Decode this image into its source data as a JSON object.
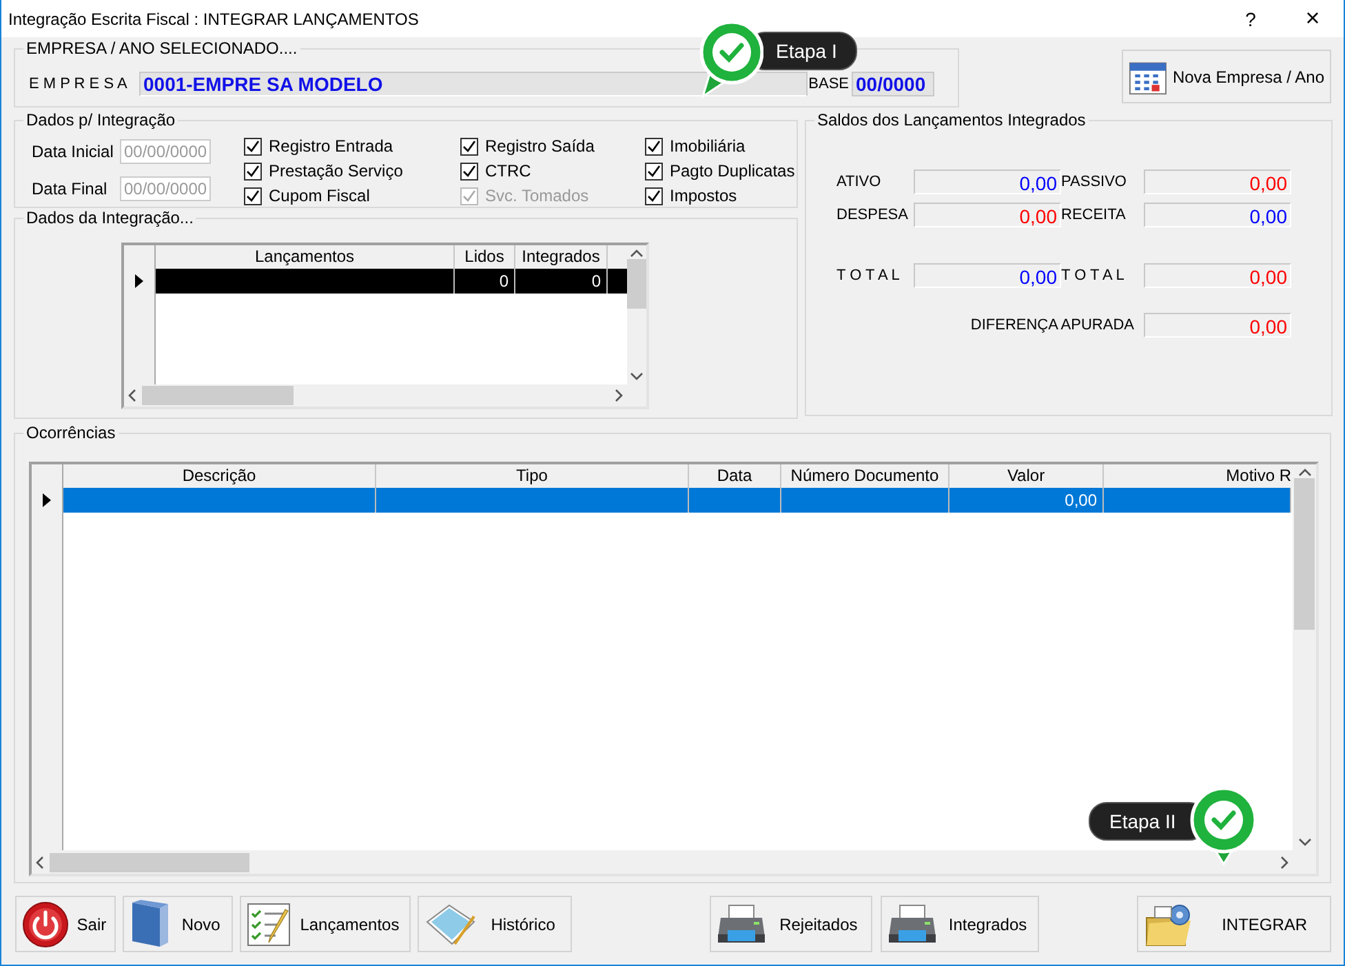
{
  "window": {
    "title": "Integração Escrita Fiscal : INTEGRAR LANÇAMENTOS",
    "help": "?",
    "close": "×"
  },
  "empresa": {
    "legend": "EMPRESA  / ANO  SELECIONADO....",
    "label": "E M P R E S A",
    "value": "0001-EMPRE SA MODELO",
    "base_label": "BASE",
    "base_value": "00/0000",
    "button": "Nova Empresa / Ano"
  },
  "dados": {
    "legend": "Dados p/ Integração",
    "dates": [
      {
        "label": "Data Inicial",
        "placeholder": "00/00/0000"
      },
      {
        "label": "Data Final",
        "placeholder": "00/00/0000"
      }
    ],
    "options": [
      {
        "label": "Registro Entrada",
        "checked": true,
        "disabled": false
      },
      {
        "label": "Prestação Serviço",
        "checked": true,
        "disabled": false
      },
      {
        "label": "Cupom Fiscal",
        "checked": true,
        "disabled": false
      },
      {
        "label": "Registro Saída",
        "checked": true,
        "disabled": false
      },
      {
        "label": "CTRC",
        "checked": true,
        "disabled": false
      },
      {
        "label": "Svc. Tomados",
        "checked": true,
        "disabled": true
      },
      {
        "label": "Imobiliária",
        "checked": true,
        "disabled": false
      },
      {
        "label": "Pagto Duplicatas",
        "checked": true,
        "disabled": false
      },
      {
        "label": "Impostos",
        "checked": true,
        "disabled": false
      }
    ]
  },
  "integracao": {
    "legend": "Dados da Integração...",
    "columns": [
      "Lançamentos",
      "Lidos",
      "Integrados"
    ],
    "rows": [
      {
        "lidos": "0",
        "integrados": "0",
        "selected": true
      }
    ]
  },
  "saldos": {
    "legend": "Saldos dos Lançamentos Integrados",
    "fields": [
      {
        "label": "ATIVO",
        "value": "0,00",
        "color": "#0000ff"
      },
      {
        "label": "PASSIVO",
        "value": "0,00",
        "color": "#ff0000"
      },
      {
        "label": "DESPESA",
        "value": "0,00",
        "color": "#ff0000"
      },
      {
        "label": "RECEITA",
        "value": "0,00",
        "color": "#0000ff"
      },
      {
        "label": "T O T A L",
        "value": "0,00",
        "color": "#0000ff"
      },
      {
        "label": "T O T A L",
        "value": "0,00",
        "color": "#ff0000"
      }
    ],
    "difference": {
      "label": "DIFERENÇA APURADA",
      "value": "0,00",
      "color": "#ff0000"
    }
  },
  "ocorrencias": {
    "legend": "Ocorrências",
    "columns": [
      "Descrição",
      "Tipo",
      "Data",
      "Número Documento",
      "Valor",
      "Motivo R"
    ],
    "rows": [
      {
        "valor": "0,00",
        "selected": true
      }
    ]
  },
  "buttons": [
    {
      "label": "Sair",
      "kind": "power"
    },
    {
      "label": "Novo",
      "kind": "book"
    },
    {
      "label": "Lançamentos",
      "kind": "checklist"
    },
    {
      "label": "Histórico",
      "kind": "notepad"
    },
    {
      "label": "Rejeitados",
      "kind": "printer"
    },
    {
      "label": "Integrados",
      "kind": "printer"
    },
    {
      "label": "INTEGRAR",
      "kind": "integrate"
    }
  ],
  "callouts": [
    {
      "label": "Etapa I"
    },
    {
      "label": "Etapa II"
    }
  ]
}
